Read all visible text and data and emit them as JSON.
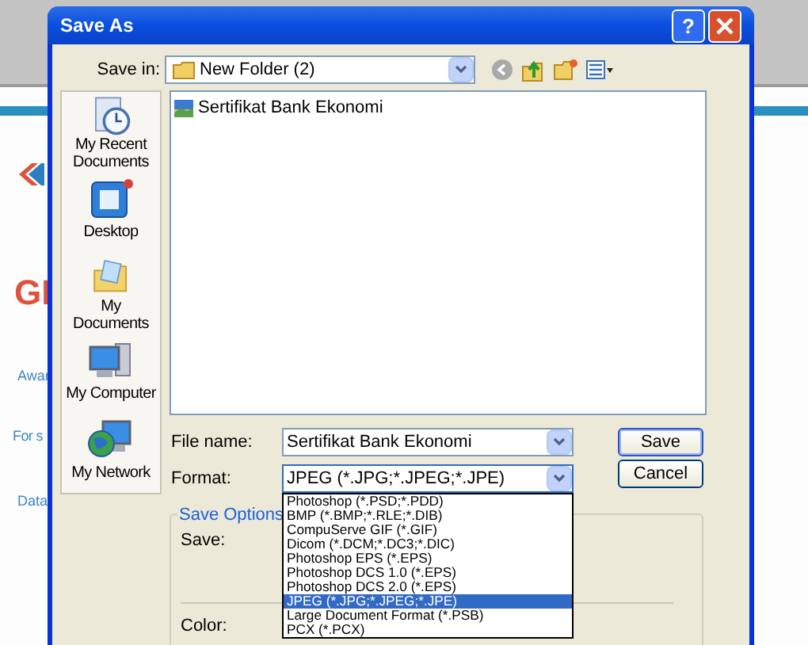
{
  "background_page": {
    "texts": [
      "GI",
      "Awar",
      "For s",
      "Data"
    ]
  },
  "dialog": {
    "title": "Save As",
    "help": "?",
    "save_in": {
      "label": "Save in:",
      "value": "New Folder (2)"
    },
    "places": [
      {
        "label": "My Recent Documents",
        "kind": "recent"
      },
      {
        "label": "Desktop",
        "kind": "desktop"
      },
      {
        "label": "My Documents",
        "kind": "documents"
      },
      {
        "label": "My Computer",
        "kind": "computer"
      },
      {
        "label": "My Network",
        "kind": "network"
      }
    ],
    "files": [
      {
        "name": "Sertifikat Bank Ekonomi",
        "selected": false
      }
    ],
    "file_name": {
      "label": "File name:",
      "value": "Sertifikat Bank Ekonomi"
    },
    "format": {
      "label": "Format:",
      "value": "JPEG (*.JPG;*.JPEG;*.JPE)",
      "expanded": true,
      "options": [
        {
          "label": "Photoshop (*.PSD;*.PDD)",
          "selected": false
        },
        {
          "label": "BMP (*.BMP;*.RLE;*.DIB)",
          "selected": false
        },
        {
          "label": "CompuServe GIF (*.GIF)",
          "selected": false
        },
        {
          "label": "Dicom (*.DCM;*.DC3;*.DIC)",
          "selected": false
        },
        {
          "label": "Photoshop EPS (*.EPS)",
          "selected": false
        },
        {
          "label": "Photoshop DCS 1.0 (*.EPS)",
          "selected": false
        },
        {
          "label": "Photoshop DCS 2.0 (*.EPS)",
          "selected": false
        },
        {
          "label": "JPEG (*.JPG;*.JPEG;*.JPE)",
          "selected": true
        },
        {
          "label": "Large Document Format (*.PSB)",
          "selected": false
        },
        {
          "label": "PCX (*.PCX)",
          "selected": false
        }
      ]
    },
    "buttons": [
      {
        "label": "Save",
        "default": true
      },
      {
        "label": "Cancel",
        "default": false
      }
    ],
    "save_options": {
      "title": "Save Options",
      "labels": [
        "Save:",
        "Color:"
      ]
    }
  }
}
